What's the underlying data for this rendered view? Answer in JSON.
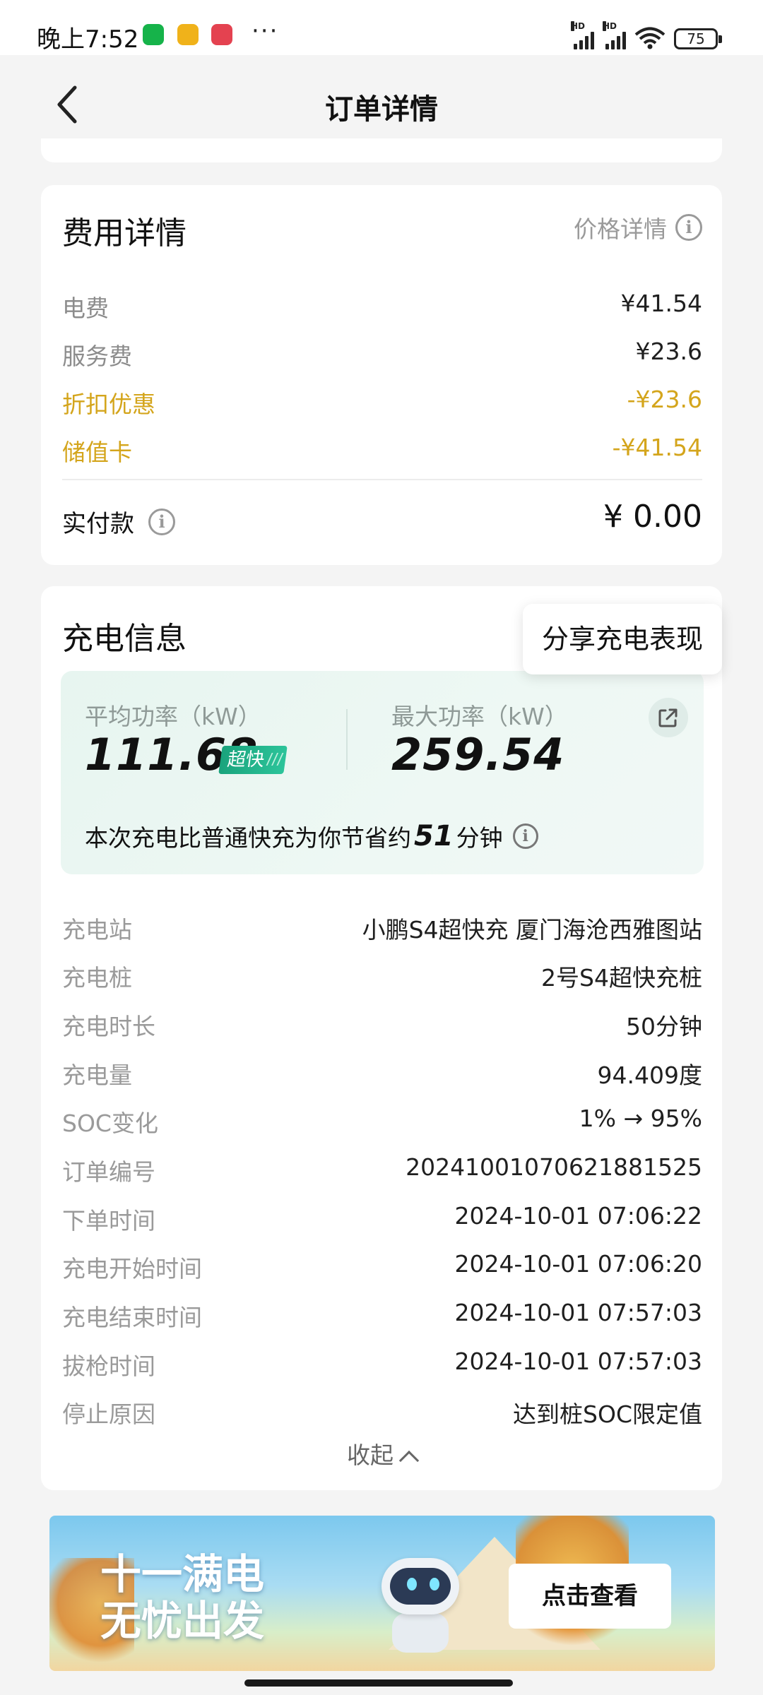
{
  "status_bar": {
    "time": "晚上7:52",
    "more": "···",
    "battery": "75",
    "signal_label": "HD"
  },
  "nav": {
    "title": "订单详情"
  },
  "fee_details": {
    "title": "费用详情",
    "price_detail_link": "价格详情",
    "items": [
      {
        "label": "电费",
        "value": "¥41.54",
        "type": "normal"
      },
      {
        "label": "服务费",
        "value": "¥23.6",
        "type": "normal"
      },
      {
        "label": "折扣优惠",
        "value": "-¥23.6",
        "type": "discount"
      },
      {
        "label": "储值卡",
        "value": "-¥41.54",
        "type": "discount"
      }
    ],
    "paid_label": "实付款",
    "paid_value": "¥ 0.00"
  },
  "charging_info": {
    "title": "充电信息",
    "share_tooltip": "分享充电表现",
    "avg_power_label": "平均功率（kW）",
    "avg_power_value": "111.68",
    "fast_badge": "超快",
    "max_power_label": "最大功率（kW）",
    "max_power_value": "259.54",
    "saving_prefix": "本次充电比普通快充为你节省约",
    "saving_minutes": "51",
    "saving_suffix": "分钟",
    "rows": [
      {
        "label": "充电站",
        "value": "小鹏S4超快充 厦门海沧西雅图站"
      },
      {
        "label": "充电桩",
        "value": "2号S4超快充桩"
      },
      {
        "label": "充电时长",
        "value": "50分钟"
      },
      {
        "label": "充电量",
        "value": "94.409度"
      },
      {
        "label": "SOC变化",
        "value": "1% → 95%"
      },
      {
        "label": "订单编号",
        "value": "20241001070621881525"
      },
      {
        "label": "下单时间",
        "value": "2024-10-01 07:06:22"
      },
      {
        "label": "充电开始时间",
        "value": "2024-10-01 07:06:20"
      },
      {
        "label": "充电结束时间",
        "value": "2024-10-01 07:57:03"
      },
      {
        "label": "拔枪时间",
        "value": "2024-10-01 07:57:03"
      },
      {
        "label": "停止原因",
        "value": "达到桩SOC限定值"
      }
    ],
    "collapse_label": "收起"
  },
  "banner": {
    "line1": "十一满电",
    "line2": "无忧出发",
    "cta": "点击查看"
  },
  "colors": {
    "discount": "#d4a51c",
    "fast_badge": "#1aa37c",
    "panel_bg": "#e7f5f0"
  },
  "icons": [
    "back-arrow-icon",
    "info-icon",
    "share-icon",
    "chevron-up-icon",
    "wifi-icon",
    "battery-icon",
    "signal-icon"
  ]
}
